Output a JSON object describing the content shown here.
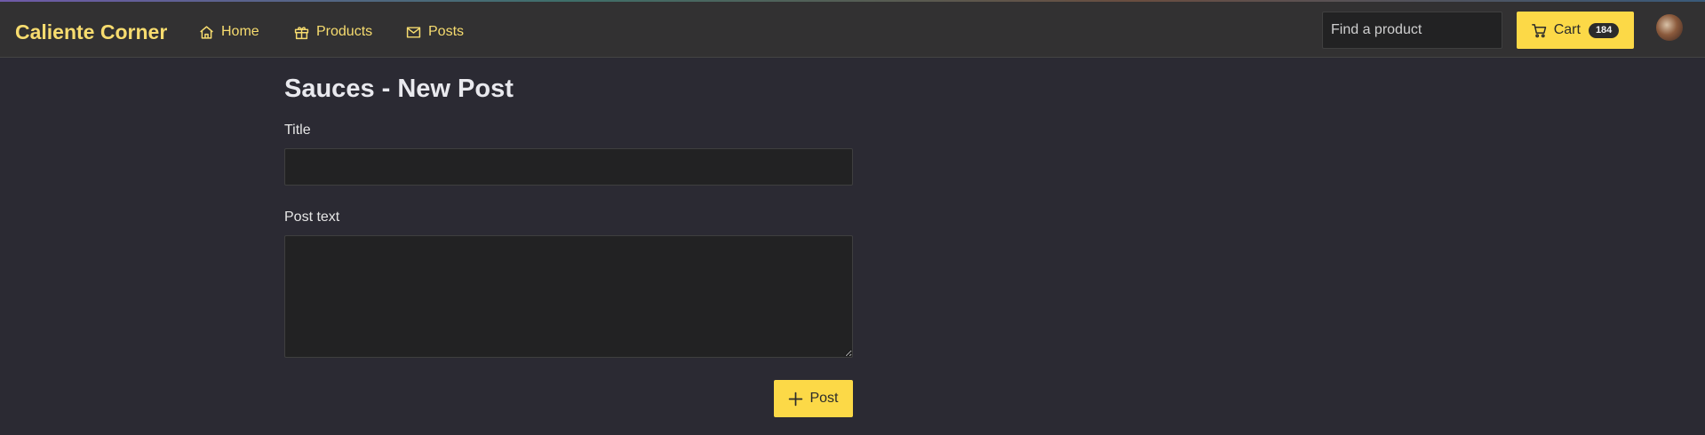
{
  "brand": {
    "name": "Caliente Corner"
  },
  "nav": {
    "home": "Home",
    "products": "Products",
    "posts": "Posts"
  },
  "search": {
    "placeholder": "Find a product"
  },
  "cart": {
    "label": "Cart",
    "count": "184"
  },
  "page": {
    "title": "Sauces - New Post"
  },
  "form": {
    "title_label": "Title",
    "title_value": "",
    "text_label": "Post text",
    "text_value": "",
    "submit_label": "Post"
  },
  "colors": {
    "accent": "#fcd947",
    "brand_text": "#f7dc6f",
    "background": "#2b2a33",
    "navbar": "#323132"
  }
}
